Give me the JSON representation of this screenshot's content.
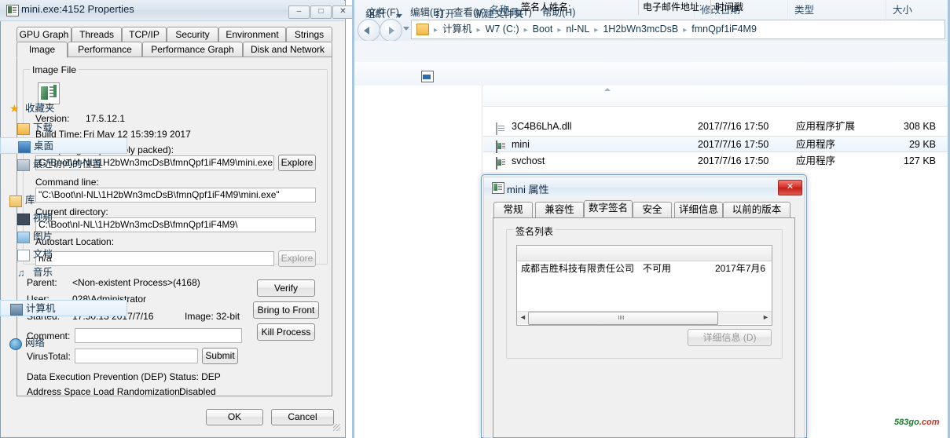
{
  "process_explorer": {
    "title": "mini.exe:4152 Properties",
    "title_icon": "application-icon",
    "caption_buttons": [
      {
        "name": "minimize",
        "glyph": "–"
      },
      {
        "name": "maximize",
        "glyph": "□"
      },
      {
        "name": "close",
        "glyph": "✕"
      }
    ],
    "tabs_row1": [
      "GPU Graph",
      "Threads",
      "TCP/IP",
      "Security",
      "Environment",
      "Strings"
    ],
    "tabs_row2": [
      "Image",
      "Performance",
      "Performance Graph",
      "Disk and Network"
    ],
    "active_tab": "Image",
    "image_tab": {
      "group_label": "Image File",
      "version_label": "Version:",
      "version_value": "17.5.12.1",
      "build_time_label": "Build Time:",
      "build_time_value": "Fri May 12 15:39:19 2017",
      "path_label": "Path (Image is probably packed):",
      "path_value": "C:\\Boot\\nl-NL\\1H2bWn3mcDsB\\fmnQpf1iF4M9\\mini.exe",
      "path_explore_button": "Explore",
      "command_line_label": "Command line:",
      "command_line_value": "\"C:\\Boot\\nl-NL\\1H2bWn3mcDsB\\fmnQpf1iF4M9\\mini.exe\"",
      "current_directory_label": "Current directory:",
      "current_directory_value": "C:\\Boot\\nl-NL\\1H2bWn3mcDsB\\fmnQpf1iF4M9\\",
      "autostart_label": "Autostart Location:",
      "autostart_value": "n/a",
      "autostart_explore_button": "Explore",
      "parent_label": "Parent:",
      "parent_value": "<Non-existent Process>(4168)",
      "user_label": "User:",
      "user_value": "028\\Administrator",
      "started_label": "Started:",
      "started_value": "17:50:13  2017/7/16",
      "image_bits_label": "Image: 32-bit",
      "comment_label": "Comment:",
      "comment_value": "",
      "virustotal_label": "VirusTotal:",
      "virustotal_value": "",
      "submit_button": "Submit",
      "dep_line": "Data Execution Prevention (DEP) Status: DEP",
      "aslr_label": "Address Space Load Randomization:",
      "aslr_value": "Disabled",
      "verify_button": "Verify",
      "bring_to_front_button": "Bring to Front",
      "kill_process_button": "Kill Process"
    },
    "ok_button": "OK",
    "cancel_button": "Cancel"
  },
  "explorer": {
    "address_bar": {
      "folder_icon": "folder-icon",
      "crumbs": [
        "计算机",
        "W7 (C:)",
        "Boot",
        "nl-NL",
        "1H2bWn3mcDsB",
        "fmnQpf1iF4M9"
      ],
      "separator": "▸"
    },
    "menu": [
      "文件(F)",
      "编辑(E)",
      "查看(V)",
      "工具(T)",
      "帮助(H)"
    ],
    "toolbar": {
      "organize": "组织",
      "open": "打开",
      "new_folder": "新建文件夹"
    },
    "sidebar": [
      {
        "label": "收藏夹",
        "icon": "star-icon",
        "root": true,
        "selected": false
      },
      {
        "label": "下载",
        "icon": "download-folder-icon",
        "root": false,
        "selected": false
      },
      {
        "label": "桌面",
        "icon": "desktop-icon",
        "root": false,
        "selected": true
      },
      {
        "label": "最近访问的位置",
        "icon": "recent-places-icon",
        "root": false,
        "selected": false
      },
      {
        "label": "库",
        "icon": "library-icon",
        "root": true,
        "selected": false
      },
      {
        "label": "视频",
        "icon": "video-icon",
        "root": false,
        "selected": false
      },
      {
        "label": "图片",
        "icon": "pictures-icon",
        "root": false,
        "selected": false
      },
      {
        "label": "文档",
        "icon": "documents-icon",
        "root": false,
        "selected": false
      },
      {
        "label": "音乐",
        "icon": "music-icon",
        "root": false,
        "selected": false
      },
      {
        "label": "计算机",
        "icon": "computer-icon",
        "root": true,
        "selected": false
      },
      {
        "label": "网络",
        "icon": "network-icon",
        "root": true,
        "selected": false
      }
    ],
    "columns": [
      "名称",
      "修改日期",
      "类型",
      "大小"
    ],
    "files": [
      {
        "name": "3C4B6LhA.dll",
        "date": "2017/7/16 17:50",
        "type": "应用程序扩展",
        "size": "308 KB",
        "icon": "dll-icon",
        "selected": false
      },
      {
        "name": "mini",
        "date": "2017/7/16 17:50",
        "type": "应用程序",
        "size": "29 KB",
        "icon": "exe-icon",
        "selected": true
      },
      {
        "name": "svchost",
        "date": "2017/7/16 17:50",
        "type": "应用程序",
        "size": "127 KB",
        "icon": "exe-icon",
        "selected": false
      }
    ]
  },
  "mini_properties": {
    "title": "mini 属性",
    "close_glyph": "✕",
    "tabs": [
      "常规",
      "兼容性",
      "数字签名",
      "安全",
      "详细信息",
      "以前的版本"
    ],
    "active_tab": "数字签名",
    "group_label": "签名列表",
    "columns": [
      "签名人姓名:",
      "电子邮件地址:",
      "时间戳"
    ],
    "row": {
      "signer": "成都吉胜科技有限责任公司",
      "email": "不可用",
      "timestamp": "2017年7月6"
    },
    "details_button": "详细信息 (D)",
    "scroll_left_glyph": "◄",
    "scroll_right_glyph": "►"
  },
  "watermark": {
    "prefix": "583",
    "suffix": "go",
    "domain": ".com"
  }
}
